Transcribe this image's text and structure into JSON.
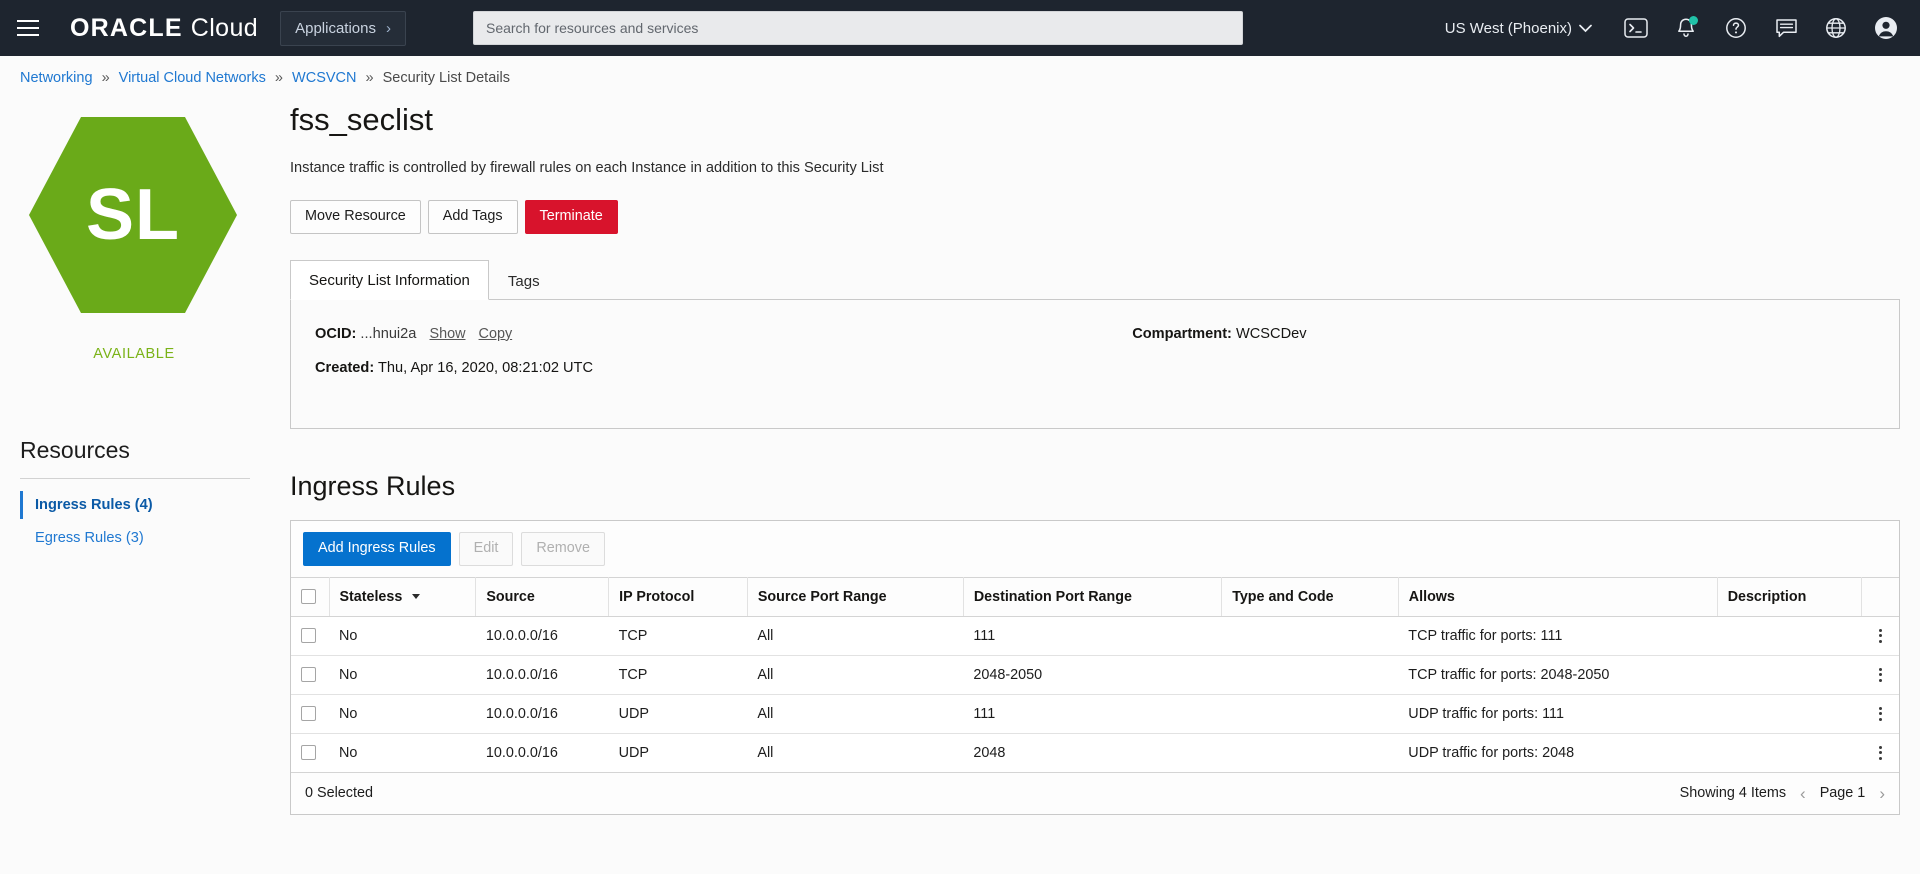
{
  "topbar": {
    "menu_icon": "hamburger-icon",
    "brand_primary": "ORACLE",
    "brand_secondary": "Cloud",
    "applications_label": "Applications",
    "applications_chevron": "›",
    "search_placeholder": "Search for resources and services",
    "search_value": "",
    "region": "US West (Phoenix)",
    "region_chevron": "⌄",
    "icons": [
      "cloud-shell-icon",
      "notifications-bell-icon",
      "help-question-icon",
      "feedback-chat-icon",
      "language-globe-icon",
      "user-avatar-icon"
    ]
  },
  "breadcrumb": {
    "items": [
      {
        "label": "Networking",
        "link": true
      },
      {
        "label": "Virtual Cloud Networks",
        "link": true
      },
      {
        "label": "WCSVCN",
        "link": true
      },
      {
        "label": "Security List Details",
        "link": false
      }
    ],
    "separator": "»"
  },
  "resource_badge": {
    "initials": "SL",
    "status": "AVAILABLE",
    "badge_color": "#6aaa19",
    "status_color": "#7ab317"
  },
  "sidebar": {
    "title": "Resources",
    "items": [
      {
        "label": "Ingress Rules (4)",
        "active": true
      },
      {
        "label": "Egress Rules (3)",
        "active": false
      }
    ]
  },
  "header": {
    "title": "fss_seclist",
    "description": "Instance traffic is controlled by firewall rules on each Instance in addition to this Security List",
    "actions": [
      {
        "label": "Move Resource",
        "style": "default"
      },
      {
        "label": "Add Tags",
        "style": "default"
      },
      {
        "label": "Terminate",
        "style": "danger"
      }
    ]
  },
  "tabs": [
    {
      "label": "Security List Information",
      "active": true
    },
    {
      "label": "Tags",
      "active": false
    }
  ],
  "details": {
    "ocid_label": "OCID:",
    "ocid_value": "...hnui2a",
    "show_link": "Show",
    "copy_link": "Copy",
    "created_label": "Created:",
    "created_value": "Thu, Apr 16, 2020, 08:21:02 UTC",
    "compartment_label": "Compartment:",
    "compartment_value": "WCSCDev"
  },
  "rules_section": {
    "title": "Ingress Rules",
    "toolbar": [
      {
        "label": "Add Ingress Rules",
        "style": "primary",
        "disabled": false
      },
      {
        "label": "Edit",
        "style": "disabled",
        "disabled": true
      },
      {
        "label": "Remove",
        "style": "disabled",
        "disabled": true
      }
    ],
    "columns": [
      "Stateless",
      "Source",
      "IP Protocol",
      "Source Port Range",
      "Destination Port Range",
      "Type and Code",
      "Allows",
      "Description"
    ],
    "sorted_column": "Stateless",
    "rows": [
      {
        "stateless": "No",
        "source": "10.0.0.0/16",
        "ip_protocol": "TCP",
        "source_port_range": "All",
        "destination_port_range": "111",
        "type_and_code": "",
        "allows": "TCP traffic for ports: 111",
        "description": ""
      },
      {
        "stateless": "No",
        "source": "10.0.0.0/16",
        "ip_protocol": "TCP",
        "source_port_range": "All",
        "destination_port_range": "2048-2050",
        "type_and_code": "",
        "allows": "TCP traffic for ports: 2048-2050",
        "description": ""
      },
      {
        "stateless": "No",
        "source": "10.0.0.0/16",
        "ip_protocol": "UDP",
        "source_port_range": "All",
        "destination_port_range": "111",
        "type_and_code": "",
        "allows": "UDP traffic for ports: 111",
        "description": ""
      },
      {
        "stateless": "No",
        "source": "10.0.0.0/16",
        "ip_protocol": "UDP",
        "source_port_range": "All",
        "destination_port_range": "2048",
        "type_and_code": "",
        "allows": "UDP traffic for ports: 2048",
        "description": ""
      }
    ],
    "footer": {
      "selected_text": "0 Selected",
      "showing_text": "Showing 4 Items",
      "page_label": "Page 1",
      "prev_chevron": "‹",
      "next_chevron": "›"
    }
  }
}
